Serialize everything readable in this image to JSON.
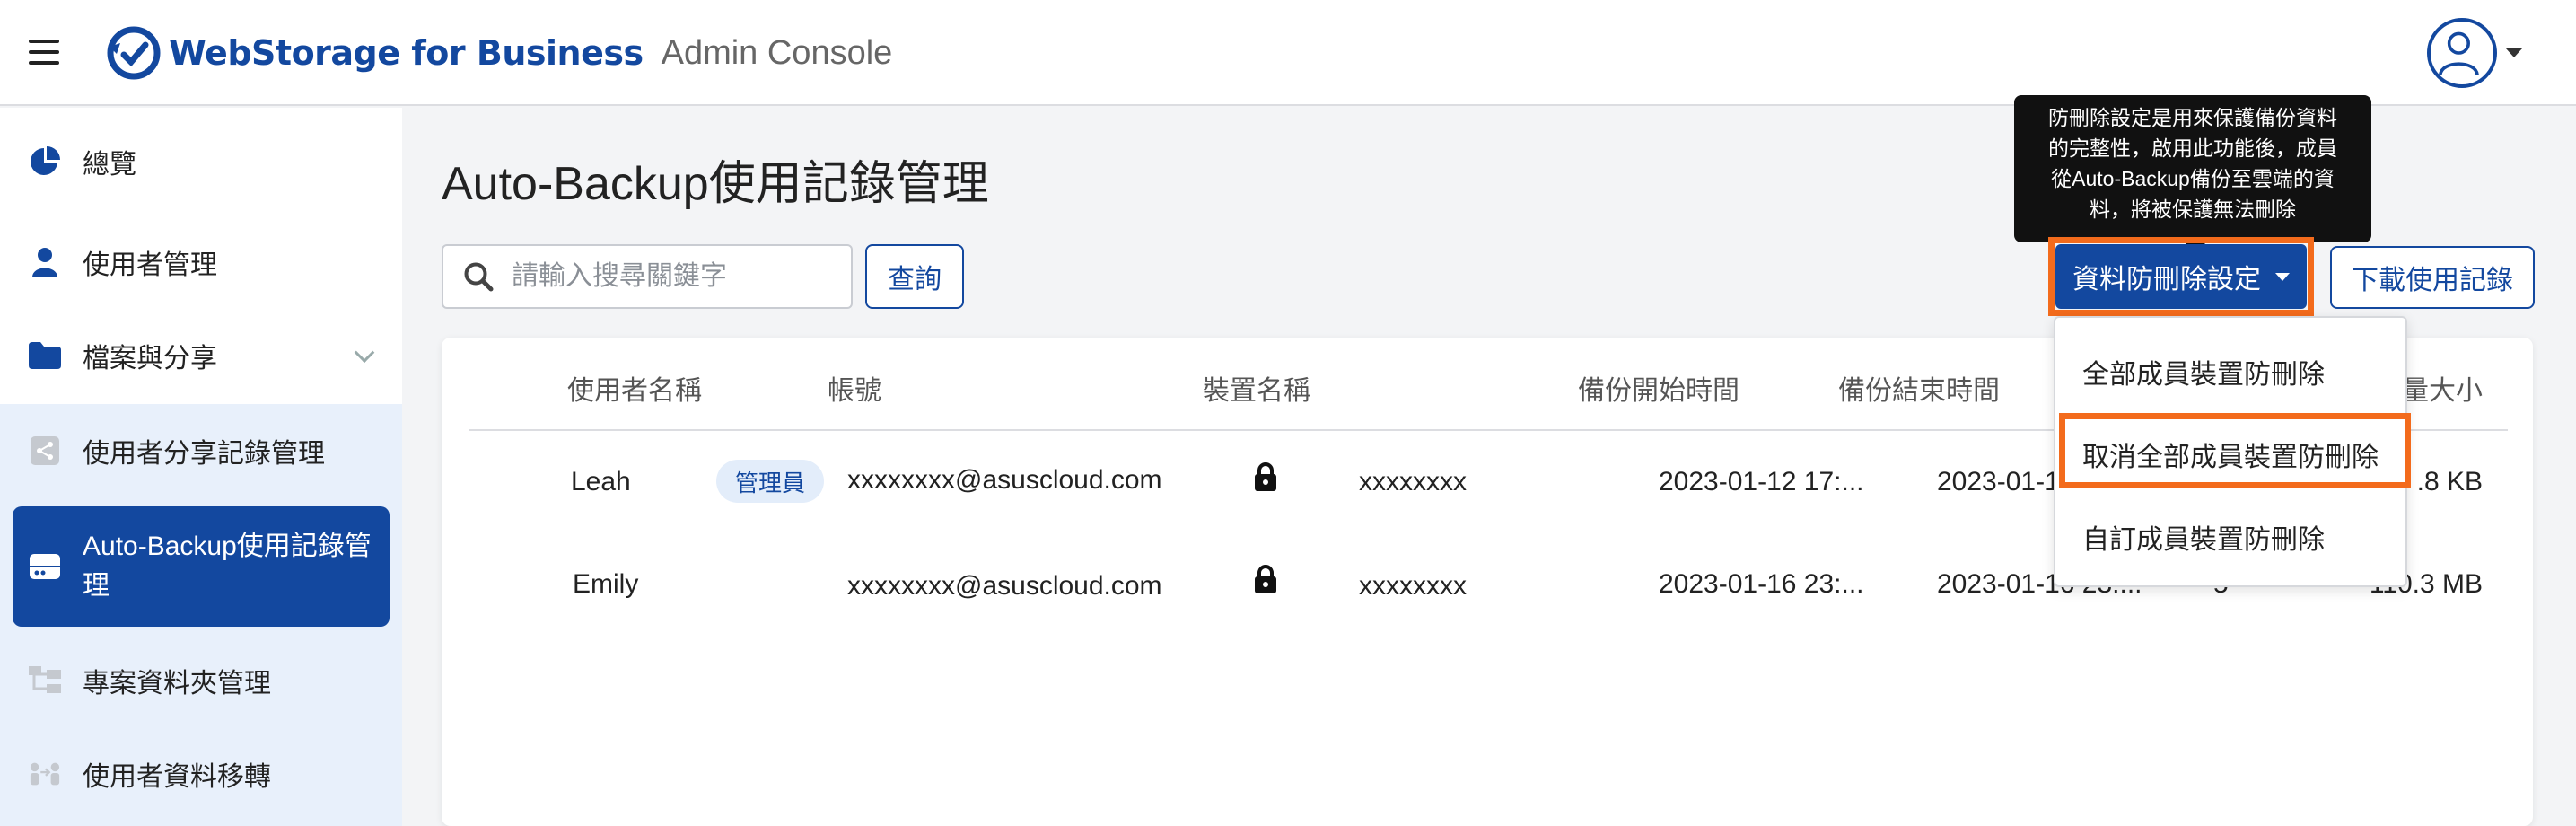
{
  "header": {
    "brand": "WebStorage for Business",
    "console": "Admin Console"
  },
  "sidebar": {
    "items": [
      {
        "label": "總覽"
      },
      {
        "label": "使用者管理"
      },
      {
        "label": "檔案與分享"
      },
      {
        "label": "使用者分享記錄管理"
      },
      {
        "label": "Auto-Backup使用記錄管理"
      },
      {
        "label": "專案資料夾管理"
      },
      {
        "label": "使用者資料移轉"
      }
    ]
  },
  "page": {
    "title": "Auto-Backup使用記錄管理"
  },
  "toolbar": {
    "search_placeholder": "請輸入搜尋關鍵字",
    "query_label": "查詢",
    "protect_label": "資料防刪除設定",
    "download_label": "下載使用記錄"
  },
  "tooltip": {
    "lines": [
      "防刪除設定是用來保護備份資料",
      "的完整性，啟用此功能後，成員",
      "從Auto-Backup備份至雲端的資",
      "料，將被保護無法刪除"
    ]
  },
  "dropdown": {
    "items": [
      "全部成員裝置防刪除",
      "取消全部成員裝置防刪除",
      "自訂成員裝置防刪除"
    ]
  },
  "table": {
    "columns": [
      "使用者名稱",
      "帳號",
      "裝置名稱",
      "備份開始時間",
      "備份結束時間",
      "量大小"
    ],
    "rows": [
      {
        "user": "Leah",
        "badge": "管理員",
        "account": "xxxxxxxx@asuscloud.com",
        "device": "xxxxxxxx",
        "start": "2023-01-12 17:...",
        "end": "2023-01-1",
        "size": ".8 KB"
      },
      {
        "user": "Emily",
        "account": "xxxxxxxx@asuscloud.com",
        "device": "xxxxxxxx",
        "start": "2023-01-16 23:...",
        "end": "2023-01-16 23:...",
        "extra": "5",
        "size": "110.3 MB"
      }
    ]
  },
  "colors": {
    "primary": "#13489f",
    "highlight": "#f36b1c"
  }
}
